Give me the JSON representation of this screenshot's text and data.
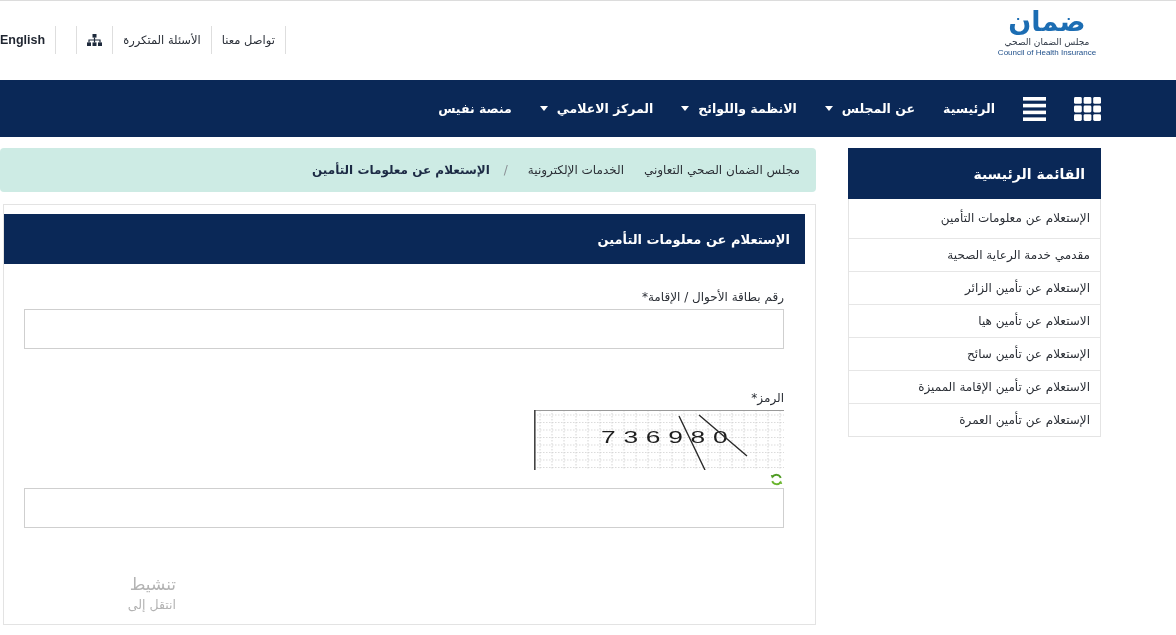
{
  "header": {
    "logo": {
      "wordmark": "ضمان",
      "subtitle": "مجلس الضمان الصحي",
      "subtitle_en": "Council of Health Insurance"
    },
    "top_links": [
      {
        "kind": "text",
        "label": "تواصل معنا"
      },
      {
        "kind": "text",
        "label": "الأسئلة المتكررة"
      },
      {
        "kind": "sitemap"
      },
      {
        "kind": "text",
        "label": "English"
      }
    ]
  },
  "nav": {
    "items": [
      {
        "kind": "apps"
      },
      {
        "kind": "menu"
      },
      {
        "kind": "link",
        "label": "الرئيسية",
        "has_dropdown": false
      },
      {
        "kind": "link",
        "label": "عن المجلس",
        "has_dropdown": true
      },
      {
        "kind": "link",
        "label": "الانظمة واللوائح",
        "has_dropdown": true
      },
      {
        "kind": "link",
        "label": "المركز الاعلامي",
        "has_dropdown": true
      },
      {
        "kind": "link",
        "label": "منصة نفيس",
        "has_dropdown": false
      }
    ]
  },
  "sidebar": {
    "title": "القائمة الرئيسية",
    "items": [
      "الإستعلام عن معلومات التأمين",
      "مقدمي خدمة الرعاية الصحية",
      "الإستعلام عن تأمين الزائر",
      "الاستعلام عن تأمين هيا",
      "الإستعلام عن تأمين سائح",
      "الاستعلام عن تأمين الإقامة المميزة",
      "الإستعلام عن تأمين العمرة"
    ]
  },
  "breadcrumb": [
    {
      "kind": "link",
      "label": "مجلس الضمان الصحي التعاوني"
    },
    {
      "kind": "link",
      "label": "الخدمات الإلكترونية"
    },
    {
      "kind": "separator",
      "label": "/"
    },
    {
      "kind": "current",
      "label": "الإستعلام عن معلومات التأمين"
    }
  ],
  "panel": {
    "title": "الإستعلام عن معلومات التأمين",
    "fields": [
      {
        "kind": "text",
        "label": "رقم بطاقة الأحوال / الإقامة*"
      },
      {
        "kind": "captcha",
        "label": "الرمز*",
        "captcha_code": "736980"
      }
    ]
  },
  "system_notice": {
    "title": "تنشيط",
    "hint": "انتقل إلى"
  }
}
